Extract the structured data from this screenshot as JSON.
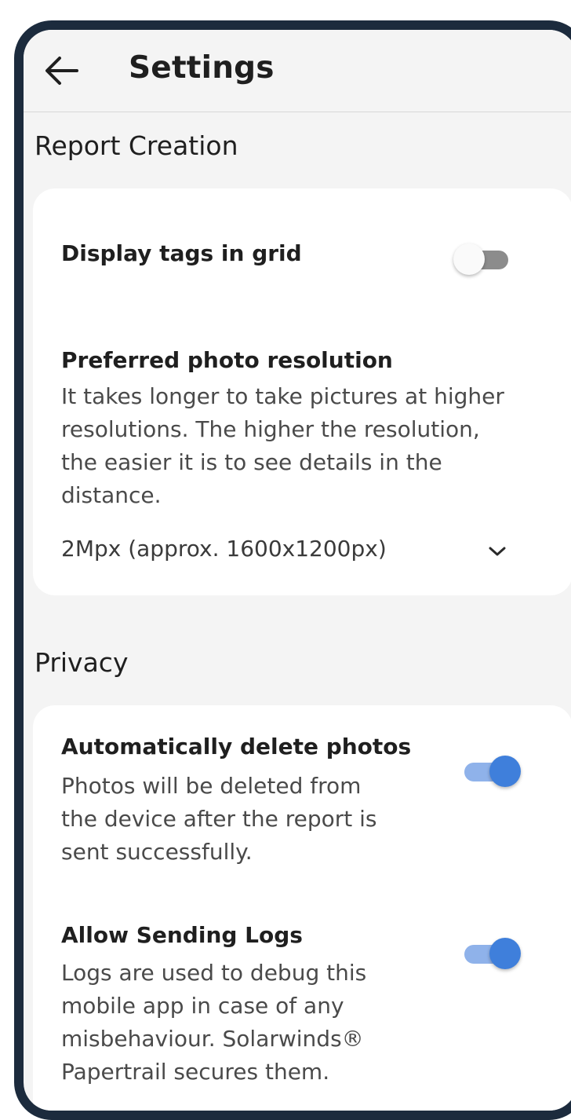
{
  "header": {
    "title": "Settings",
    "back_icon": "arrow-left-icon"
  },
  "sections": [
    {
      "title": "Report Creation",
      "items": [
        {
          "title": "Display tags in grid",
          "toggle": false
        },
        {
          "title": "Preferred photo resolution",
          "description_lines": [
            "It takes longer to take pictures at higher",
            "resolutions. The higher the resolution,",
            "the easier it is to see details in the",
            "distance."
          ],
          "selected_value": "2Mpx (approx. 1600x1200px)",
          "dropdown_icon": "chevron-down-icon"
        }
      ]
    },
    {
      "title": "Privacy",
      "items": [
        {
          "title": "Automatically delete photos",
          "description_lines": [
            "Photos will be deleted from",
            "the device after the report is",
            "sent successfully."
          ],
          "toggle": true
        },
        {
          "title": "Allow Sending Logs",
          "description_lines": [
            "Logs are used to debug this",
            "mobile app in case of any",
            "misbehaviour. Solarwinds®",
            "Papertrail secures them."
          ],
          "toggle": true
        }
      ]
    }
  ],
  "colors": {
    "accent": "#3f7fdb",
    "accent_track": "#8fb2ea",
    "frame": "#1c2b3d",
    "background": "#f4f4f4",
    "card": "#ffffff"
  }
}
